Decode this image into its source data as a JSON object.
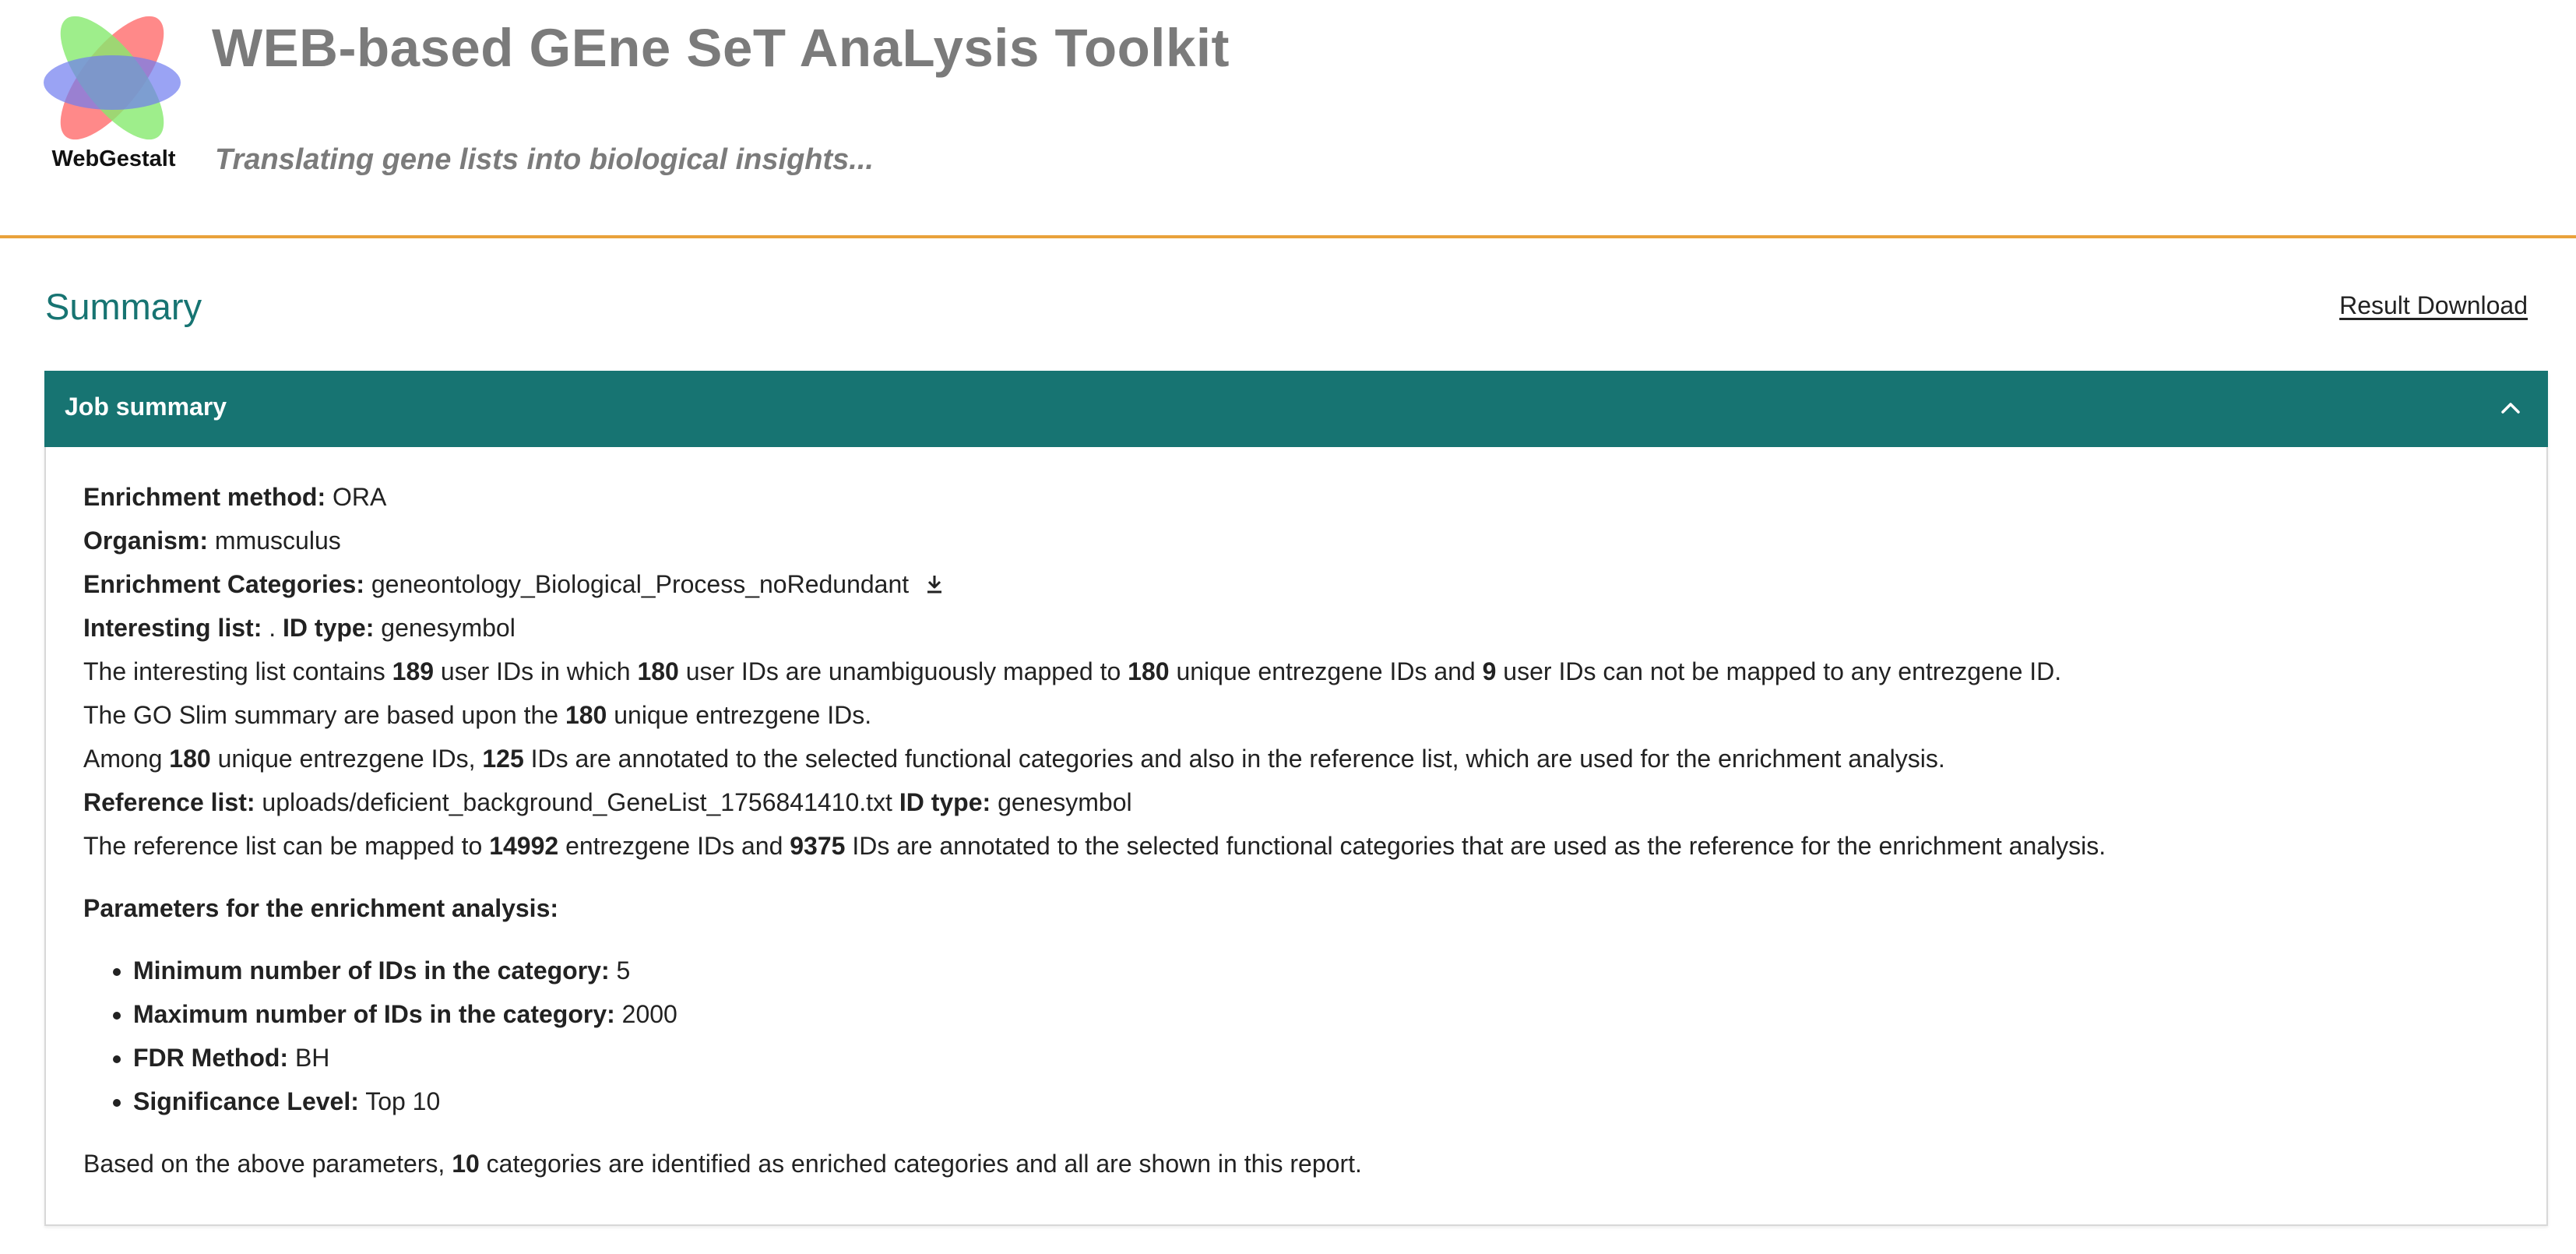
{
  "header": {
    "logo_text": "WebGestalt",
    "title": "WEB-based GEne SeT AnaLysis Toolkit",
    "tagline": "Translating gene lists into biological insights...",
    "accent_color": "#e9a23b"
  },
  "summary": {
    "title": "Summary",
    "download_label": "Result Download",
    "panel_title": "Job summary",
    "panel_color": "#177472",
    "method": {
      "label": "Enrichment method:",
      "value": "ORA"
    },
    "organism": {
      "label": "Organism:",
      "value": "mmusculus"
    },
    "categories": {
      "label": "Enrichment Categories:",
      "value": "geneontology_Biological_Process_noRedundant"
    },
    "interesting": {
      "label": "Interesting list:",
      "value": ".",
      "id_type_label": "ID type:",
      "id_type": "genesymbol"
    },
    "mapping": {
      "t1": "The interesting list contains",
      "n1": "189",
      "t2": "user IDs in which",
      "n2": "180",
      "t3": "user IDs are unambiguously mapped to",
      "n3": "180",
      "t4": "unique entrezgene IDs and",
      "n4": "9",
      "t5": "user IDs can not be mapped to any entrezgene ID."
    },
    "goslim": {
      "t1": "The GO Slim summary are based upon the",
      "n1": "180",
      "t2": "unique entrezgene IDs."
    },
    "annotated": {
      "t1": "Among",
      "n1": "180",
      "t2": "unique entrezgene IDs,",
      "n2": "125",
      "t3": "IDs are annotated to the selected functional categories and also in the reference list, which are used for the enrichment analysis."
    },
    "reference": {
      "label": "Reference list:",
      "value": "uploads/deficient_background_GeneList_1756841410.txt",
      "id_type_label": "ID type:",
      "id_type": "genesymbol"
    },
    "ref_mapping": {
      "t1": "The reference list can be mapped to",
      "n1": "14992",
      "t2": "entrezgene IDs and",
      "n2": "9375",
      "t3": "IDs are annotated to the selected functional categories that are used as the reference for the enrichment analysis."
    },
    "params_title": "Parameters for the enrichment analysis:",
    "params": [
      {
        "label": "Minimum number of IDs in the category:",
        "value": "5"
      },
      {
        "label": "Maximum number of IDs in the category:",
        "value": "2000"
      },
      {
        "label": "FDR Method:",
        "value": "BH"
      },
      {
        "label": "Significance Level:",
        "value": "Top 10"
      }
    ],
    "conclusion": {
      "t1": "Based on the above parameters,",
      "n1": "10",
      "t2": "categories are identified as enriched categories and all are shown in this report."
    }
  }
}
